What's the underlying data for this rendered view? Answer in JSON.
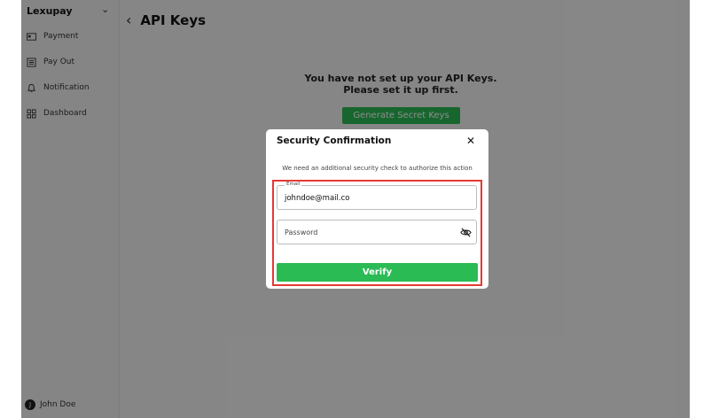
{
  "sidebar": {
    "brand": "Lexupay",
    "items": [
      {
        "label": "Payment",
        "icon": "card-icon"
      },
      {
        "label": "Pay Out",
        "icon": "list-icon"
      },
      {
        "label": "Notification",
        "icon": "bell-icon"
      },
      {
        "label": "Dashboard",
        "icon": "grid-icon"
      }
    ],
    "user": {
      "initial": "J",
      "name": "John Doe"
    }
  },
  "header": {
    "title": "API Keys"
  },
  "empty_state": {
    "line1": "You have not set up your API Keys.",
    "line2": "Please set it up first.",
    "button": "Generate Secret Keys"
  },
  "modal": {
    "title": "Security Confirmation",
    "close": "✕",
    "subtitle": "We need an additional security check to authorize this action",
    "email_label": "Email",
    "email_value": "johndoe@mail.co",
    "password_placeholder": "Password",
    "verify_label": "Verify"
  },
  "colors": {
    "accent": "#2bbb55",
    "highlight": "#e53935"
  }
}
